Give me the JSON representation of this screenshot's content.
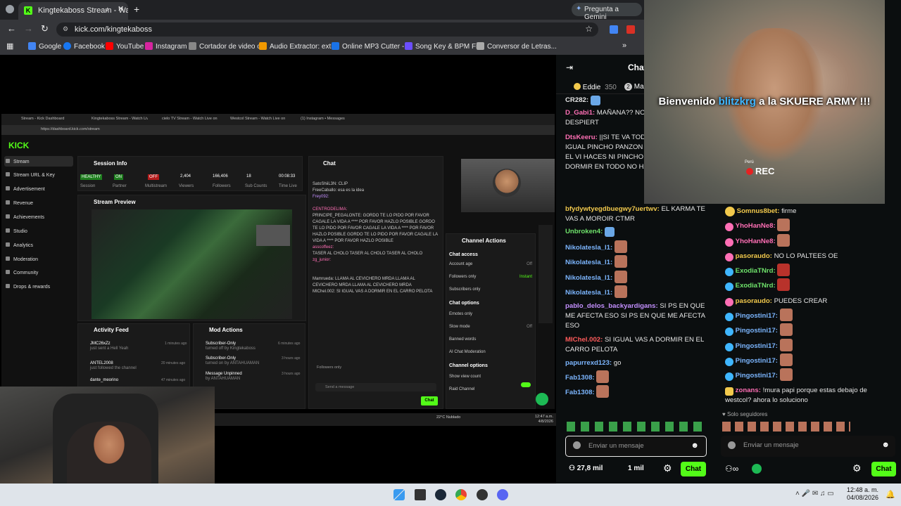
{
  "browser": {
    "tab_title": "Kingtekaboss Stream - Watc",
    "url": "kick.com/kingtekaboss",
    "gemini_label": "Pregunta a Gemini",
    "bookmarks": [
      "Google",
      "Facebook",
      "YouTube",
      "Instagram",
      "Cortador de video o...",
      "Audio Extractor: extr...",
      "Online MP3 Cutter -...",
      "Song Key & BPM Fi...",
      "Conversor de Letras..."
    ]
  },
  "stream": {
    "inner_window": {
      "tabs": [
        "Stream - Kick Dashboard",
        "Kingtekaboss Stream - Watch Liv...",
        "cielo TV Stream - Watch Live on K...",
        "Westcol Stream - Watch Live on K...",
        "(1) Instagram • Messages"
      ],
      "url": "https://dashboard.kick.com/stream",
      "logo": "KICK",
      "sidebar": [
        "Stream",
        "Stream URL & Key",
        "Advertisement",
        "Revenue",
        "Achievements",
        "Studio",
        "Analytics",
        "Moderation",
        "Community",
        "Drops & rewards"
      ],
      "session_info": {
        "title": "Session Info",
        "stats": [
          {
            "value": "HEALTHY",
            "label": "Session"
          },
          {
            "value": "ON",
            "label": "Partner"
          },
          {
            "value": "OFF",
            "label": "Multistream"
          },
          {
            "value": "2,404",
            "label": "Viewers"
          },
          {
            "value": "166,406",
            "label": "Followers"
          },
          {
            "value": "18",
            "label": "Sub Counts"
          },
          {
            "value": "00:08:33",
            "label": "Time Live"
          }
        ]
      },
      "stream_preview": "Stream Preview",
      "activity_feed": {
        "title": "Activity Feed",
        "items": [
          {
            "name": "JMC26xZz",
            "detail": "just sent a Hell Yeah",
            "time": "1 minutes ago"
          },
          {
            "name": "ANTEL2008",
            "detail": "just followed the channel",
            "time": "20 minutes ago"
          },
          {
            "name": "dante_meorino",
            "detail": "just followed the channel",
            "time": "47 minutes ago"
          }
        ]
      },
      "mod_actions": {
        "title": "Mod Actions",
        "items": [
          {
            "name": "Subscriber-Only",
            "detail": "turned off by Kingtekaboss",
            "time": "6 minutes ago"
          },
          {
            "name": "Subscriber-Only",
            "detail": "turned on by ANTAHUAMAN",
            "time": "3 hours ago"
          },
          {
            "name": "Message Unpinned",
            "detail": "by ANTAHUAMAN",
            "time": "3 hours ago"
          }
        ]
      },
      "chat": {
        "title": "Chat",
        "lines": [
          "SatoShiiL3N: CLIP",
          "FreeCaballo: esa es la idea",
          "Frey092:",
          "CENTRODELIMA:",
          "PRINCIPE_PEGALONTE: GORDO TE LO PIDO POR FAVOR CAGALE LA VIDA A **** POR FAVOR HAZLO POSIBLE GORDO TE LO PIDO POR FAVOR CAGALE LA VIDA A **** POR FAVOR HAZLO POSIBLE GORDO TE LO PIDO POR FAVOR CAGALE LA VIDA A **** POR FAVOR HAZLO POSIBLE",
          "asscoffeez:",
          "TASER AL CHOLO TASER AL CHOLO TASER AL CHOLO",
          "zg_junior:",
          "Mamrueda: LLAMA AL CEVICHERO MRDA LLAMA AL CEVICHERO MRDA LLAMA AL CEVICHERO MRDA",
          "MIChel.002: SI IGUAL VAS A DORMIR EN EL CARRO PELOTA"
        ],
        "followers_only": "Followers only",
        "placeholder": "Send a message",
        "send": "Chat"
      },
      "channel_actions": {
        "title": "Channel Actions",
        "chat_access": "Chat access",
        "rows_access": [
          {
            "label": "Account age",
            "value": "Off"
          },
          {
            "label": "Followers only",
            "value": "Instant"
          },
          {
            "label": "Subscribers only",
            "value": ""
          }
        ],
        "chat_options": "Chat options",
        "rows_options": [
          {
            "label": "Emotes only",
            "value": ""
          },
          {
            "label": "Slow mode",
            "value": "Off"
          },
          {
            "label": "Banned words",
            "value": ""
          },
          {
            "label": "AI Chat Moderation",
            "value": ""
          }
        ],
        "channel_options": "Channel options",
        "rows_channel": [
          {
            "label": "Show view count",
            "value": ""
          },
          {
            "label": "Raid Channel",
            "value": ""
          }
        ]
      },
      "taskbar_weather": "22°C Nublado",
      "taskbar_time": "12:47 a.m.",
      "taskbar_date": "4/8/2026"
    }
  },
  "kick_chat": {
    "header": "Chat",
    "leaders": [
      {
        "rank": "",
        "name": "Eddie",
        "value": "350"
      },
      {
        "rank": "2",
        "name": "Ma",
        "value": ""
      }
    ],
    "messages": [
      {
        "user": "CR282:",
        "text": "",
        "color": "#e6e6e6"
      },
      {
        "user": "D_Gabi1:",
        "text": "MAÑANA?? NO ME QUEDE DESPIERT",
        "color": "#ff6fb5"
      },
      {
        "user": "DtsKeeru:",
        "text": "||SI TE VA TODO EL VIAJE E IGUAL PINCHO PANZON DORMIR EN TODO EL VI HACES NI PINCHO PANZ VAS A DORMIR EN TODO NO HACES NI PINCHO PA",
        "color": "#ff6fb5"
      },
      {
        "user": "bfydywtyegdbuegwy7uertwv:",
        "text": "EL KARMA TE VAS A MOROIR CTMR",
        "color": "#f2c94c"
      },
      {
        "user": "Unbroken4:",
        "text": "",
        "color": "#6fe36b"
      },
      {
        "user": "Nikolatesla_l1:",
        "text": "",
        "color": "#7cb6ff"
      },
      {
        "user": "Nikolatesla_l1:",
        "text": "",
        "color": "#7cb6ff"
      },
      {
        "user": "Nikolatesla_l1:",
        "text": "",
        "color": "#7cb6ff"
      },
      {
        "user": "Nikolatesla_l1:",
        "text": "",
        "color": "#7cb6ff"
      },
      {
        "user": "pablo_delos_backyardigans:",
        "text": "SI PS EN QUE ME AFECTA ESO SI PS EN QUE ME AFECTA ESO",
        "color": "#c490ff"
      },
      {
        "user": "MIChel.002:",
        "text": "SI IGUAL VAS A DORMIR EN EL CARRO PELOTA",
        "color": "#ff5b5b"
      },
      {
        "user": "papurrexd123:",
        "text": "go",
        "color": "#7cb6ff"
      },
      {
        "user": "Fab1308:",
        "text": "",
        "color": "#7cb6ff"
      },
      {
        "user": "Fab1308:",
        "text": "",
        "color": "#7cb6ff"
      }
    ],
    "placeholder": "Enviar un mensaje",
    "viewers": "27,8 mil",
    "followers": "1 mil",
    "send": "Chat"
  },
  "overlay": {
    "welcome_prefix": "Bienvenido",
    "welcome_name": "blitzkrg",
    "welcome_suffix": "a la SKUERE ARMY !!!",
    "rec": "REC",
    "watermark": "Perú"
  },
  "westcol_chat": {
    "messages": [
      {
        "user": "Somnus8bet:",
        "text": "firme",
        "color": "#f2c94c"
      },
      {
        "user": "YhoHanNe8:",
        "text": "",
        "color": "#ff6fb5"
      },
      {
        "user": "YhoHanNe8:",
        "text": "",
        "color": "#ff6fb5"
      },
      {
        "user": "pasoraudo:",
        "text": "NO LO PALTEES OE",
        "color": "#f2c94c"
      },
      {
        "user": "ExodiaTNrd:",
        "text": "",
        "color": "#6fe36b"
      },
      {
        "user": "ExodiaTNrd:",
        "text": "",
        "color": "#6fe36b"
      },
      {
        "user": "pasoraudo:",
        "text": "PUEDES CREAR",
        "color": "#f2c94c"
      },
      {
        "user": "Pingostini17:",
        "text": "",
        "color": "#7cb6ff"
      },
      {
        "user": "Pingostini17:",
        "text": "",
        "color": "#7cb6ff"
      },
      {
        "user": "Pingostini17:",
        "text": "",
        "color": "#7cb6ff"
      },
      {
        "user": "Pingostini17:",
        "text": "",
        "color": "#7cb6ff"
      },
      {
        "user": "Pingostini17:",
        "text": "",
        "color": "#7cb6ff"
      },
      {
        "user": "zonans:",
        "text": "!mura papi porque estas debajo de westcol? ahora lo soluciono",
        "color": "#ff6fb5"
      }
    ],
    "followers_only": "Solo seguidores",
    "placeholder": "Enviar un mensaje",
    "send": "Chat"
  },
  "taskbar": {
    "time": "12:48 a. m.",
    "date": "04/08/2026"
  },
  "colors": {
    "kick_green": "#53fc18",
    "background": "#0b0e0f"
  }
}
